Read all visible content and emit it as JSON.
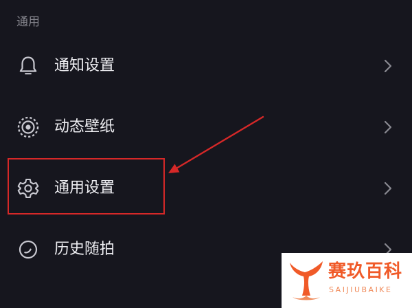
{
  "section": {
    "title": "通用"
  },
  "menu": {
    "items": [
      {
        "label": "通知设置",
        "icon": "bell-icon"
      },
      {
        "label": "动态壁纸",
        "icon": "live-wallpaper-icon"
      },
      {
        "label": "通用设置",
        "icon": "gear-icon"
      },
      {
        "label": "历史随拍",
        "icon": "history-icon"
      }
    ]
  },
  "annotation": {
    "color": "#d62828",
    "highlighted_item": "通用设置"
  },
  "watermark": {
    "title": "赛玖百科",
    "subtitle": "SAIJIUBAIKE",
    "color": "#f05a28"
  }
}
